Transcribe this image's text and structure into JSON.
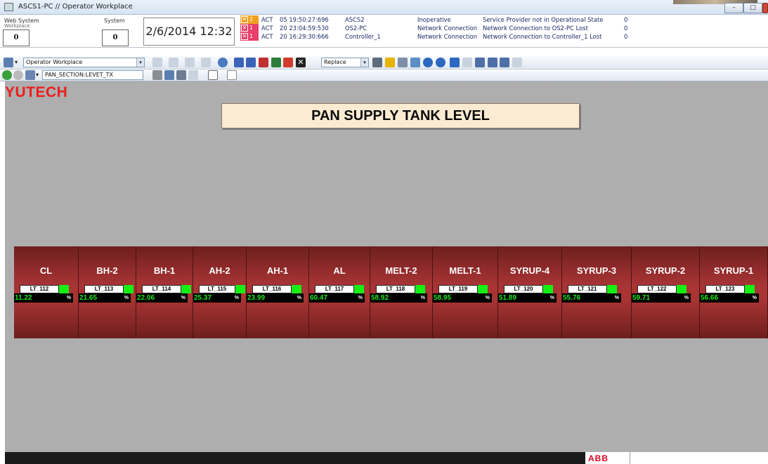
{
  "window": {
    "title": "ASCS1-PC // Operator Workplace",
    "minimize_glyph": "–",
    "maximize_glyph": "□",
    "close_glyph": "x"
  },
  "status": {
    "web_system_label": "Web System",
    "web_system_sub": "Workplace",
    "web_system_count": "0",
    "system_label": "System",
    "system_count": "0",
    "datetime": "2/6/2014 12:32"
  },
  "alarms": [
    {
      "count": "2",
      "state": "ACT",
      "time": "05 19:50:27:696",
      "source": "ASCS2",
      "type": "Inoperative",
      "message": "Service Provider not in Operational State",
      "value": "0",
      "color": "#f0a020"
    },
    {
      "count": "1",
      "state": "ACT",
      "time": "20 23:04:59:530",
      "source": "OS2-PC",
      "type": "Network Connection",
      "message": "Network Connection to OS2-PC Lost",
      "value": "0",
      "color": "#e8406a"
    },
    {
      "count": "1",
      "state": "ACT",
      "time": "20 16:29:30:666",
      "source": "Controller_1",
      "type": "Network Connection",
      "message": "Network Connection to Controller_1 Lost",
      "value": "0",
      "color": "#e8406a"
    }
  ],
  "toolbar": {
    "workplace_select": "Operator Workplace",
    "path_select": "PAN_SECTION:LEVET_TX",
    "replace_combo": "Replace",
    "dropdown_glyph": "▾"
  },
  "display": {
    "brand": "YUTECH",
    "page_title": "PAN SUPPLY TANK LEVEL",
    "unit": "%",
    "tanks": [
      {
        "name": "CL",
        "tag": "LT_112",
        "value": "11.22",
        "level_pct": 11.22
      },
      {
        "name": "BH-2",
        "tag": "LT_113",
        "value": "21.65",
        "level_pct": 21.65
      },
      {
        "name": "BH-1",
        "tag": "LT_114",
        "value": "22.06",
        "level_pct": 22.06
      },
      {
        "name": "AH-2",
        "tag": "LT_115",
        "value": "25.37",
        "level_pct": 25.37
      },
      {
        "name": "AH-1",
        "tag": "LT_116",
        "value": "23.99",
        "level_pct": 23.99
      },
      {
        "name": "AL",
        "tag": "LT_117",
        "value": "60.47",
        "level_pct": 60.47
      },
      {
        "name": "MELT-2",
        "tag": "LT_118",
        "value": "58.92",
        "level_pct": 58.92
      },
      {
        "name": "MELT-1",
        "tag": "LT_119",
        "value": "58.95",
        "level_pct": 58.95
      },
      {
        "name": "SYRUP-4",
        "tag": "LT_120",
        "value": "51.89",
        "level_pct": 51.89
      },
      {
        "name": "SYRUP-3",
        "tag": "LT_121",
        "value": "55.76",
        "level_pct": 55.76
      },
      {
        "name": "SYRUP-2",
        "tag": "LT_122",
        "value": "59.71",
        "level_pct": 59.71
      },
      {
        "name": "SYRUP-1",
        "tag": "LT_123",
        "value": "56.66",
        "level_pct": 56.66
      }
    ]
  },
  "footer": {
    "logo": "ABB"
  }
}
